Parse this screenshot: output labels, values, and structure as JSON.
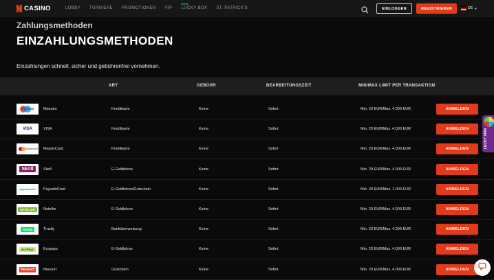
{
  "header": {
    "logo_text": "CASINO",
    "nav": [
      {
        "label": "LOBBY",
        "badge": ""
      },
      {
        "label": "TURNIERE",
        "badge": ""
      },
      {
        "label": "PROMOTIONEN",
        "badge": ""
      },
      {
        "label": "VIP",
        "badge": ""
      },
      {
        "label": "LUCKY BOX",
        "badge": "NEW"
      },
      {
        "label": "ST. PATRICK'S",
        "badge": ""
      }
    ],
    "login_label": "EINLOGGEN",
    "register_label": "REGISTRIEREN",
    "language": "DE"
  },
  "page": {
    "breadcrumb": "Zahlungsmethoden",
    "title": "EINZAHLUNGSMETHODEN",
    "subtitle": "Einzahlungen schnell, sicher und gebührenfrei vornehmen."
  },
  "table": {
    "headers": {
      "art": "ART",
      "fee": "GEBÜHR",
      "processing": "BEARBEITUNGSZEIT",
      "limit": "MIN/MAX LIMIT PER TRANSAKTION"
    },
    "rows": [
      {
        "logo": "maestro",
        "logo_text": "Maestro",
        "name": "Maestro",
        "art": "Kreditkarte",
        "fee": "Keine",
        "time": "Sofort",
        "limit": "Min. 20 EUR/Max. 4.000 EUR",
        "button": "ANMELDEN"
      },
      {
        "logo": "visa",
        "logo_text": "VISA",
        "name": "VISA",
        "art": "Kreditkarte",
        "fee": "Keine",
        "time": "Sofort",
        "limit": "Min. 20 EUR/Max. 4.000 EUR",
        "button": "ANMELDEN"
      },
      {
        "logo": "mastercard",
        "logo_text": "mastercard",
        "name": "MasterCard",
        "art": "Kreditkarte",
        "fee": "Keine",
        "time": "Sofort",
        "limit": "Min. 20 EUR/Max. 4.000 EUR",
        "button": "ANMELDEN"
      },
      {
        "logo": "skrill",
        "logo_text": "Skrill",
        "name": "Skrill",
        "art": "E-Geldbörse",
        "fee": "Keine",
        "time": "Sofort",
        "limit": "Min. 20 EUR/Max. 4.000 EUR",
        "button": "ANMELDEN"
      },
      {
        "logo": "paysafecard",
        "logo_text": "paysafecard",
        "name": "PaysafeCard",
        "art": "E-Geldbörse/Gutschein",
        "fee": "Keine",
        "time": "Sofort",
        "limit": "Min. 20 EUR/Max. 1.000 EUR",
        "button": "ANMELDEN"
      },
      {
        "logo": "neteller",
        "logo_text": "NETELLER",
        "name": "Neteller",
        "art": "E-Geldbörse",
        "fee": "Keine",
        "time": "Sofort",
        "limit": "Min. 20 EUR/Max. 4.000 EUR",
        "button": "ANMELDEN"
      },
      {
        "logo": "trustly",
        "logo_text": "Trustly",
        "name": "Trustly",
        "art": "Banküberweisung",
        "fee": "Keine",
        "time": "Sofort",
        "limit": "Min. 20 EUR/Max. 4.000 EUR",
        "button": "ANMELDEN"
      },
      {
        "logo": "ecopayz",
        "logo_text": "ecoPayz",
        "name": "Ecopayz",
        "art": "E-Geldbörse",
        "fee": "Keine",
        "time": "Sofort",
        "limit": "Min. 20 EUR/Max. 4.000 EUR",
        "button": "ANMELDEN"
      },
      {
        "logo": "neosurf",
        "logo_text": "Neosurf",
        "name": "Neosurf",
        "art": "Gutschein",
        "fee": "Keine",
        "time": "Sofort",
        "limit": "Min. 20 EUR/Max. 4.000 EUR",
        "button": "ANMELDEN"
      }
    ]
  },
  "lucky_spin": {
    "line1": "LUCKY",
    "line2": "SPIN"
  },
  "colors": {
    "accent": "#e23b1c",
    "background": "#0a0a0a",
    "header": "#171717",
    "new_badge": "#3fd35c"
  },
  "icons": {
    "search": "search-icon",
    "chat": "chat-icon",
    "flag": "german-flag-icon",
    "chevron": "chevron-down-icon"
  }
}
